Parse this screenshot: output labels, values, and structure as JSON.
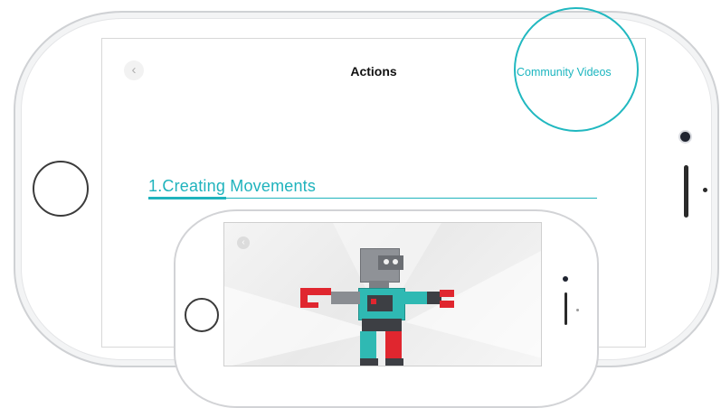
{
  "nav": {
    "back_glyph": "‹",
    "title": "Actions",
    "community_videos_label": "Community Videos"
  },
  "section": {
    "heading": "1.Creating Movements"
  },
  "inner_screen": {
    "back_glyph": "‹"
  },
  "colors": {
    "accent": "#1fb3bd",
    "highlight_circle": "#21b8c0",
    "robot_gray": "#8c8f93",
    "robot_red": "#e0262f",
    "robot_teal": "#2fb9b3"
  },
  "icons": {
    "back": "chevron-left-icon",
    "home_button": "home-button-icon"
  }
}
